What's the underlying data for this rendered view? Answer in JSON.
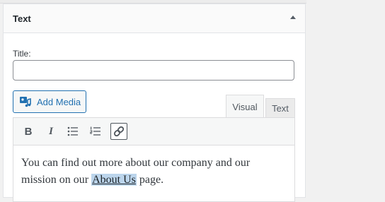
{
  "widget": {
    "title": "Text",
    "title_field_label": "Title:",
    "title_field_value": ""
  },
  "editor": {
    "add_media_label": "Add Media",
    "tabs": {
      "visual": "Visual",
      "text": "Text"
    },
    "active_tab": "Visual",
    "content": {
      "before_link": "You can find out more about our company and our mission on our ",
      "link_text": "About Us",
      "after_link": " page."
    }
  },
  "colors": {
    "accent": "#2271b1",
    "link_highlight": "#bcd5ec"
  },
  "icons": [
    "arrow-up-icon",
    "media-icon",
    "bold-icon",
    "italic-icon",
    "bullet-list-icon",
    "numbered-list-icon",
    "link-icon"
  ]
}
